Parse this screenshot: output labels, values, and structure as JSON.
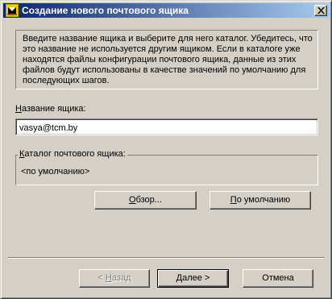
{
  "window": {
    "title": "Создание нового почтового ящика"
  },
  "description": "Введите название ящика и выберите для него каталог. Убедитесь, что это название не используется другим ящиком. Если в каталоге уже находятся файлы конфигурации почтового ящика, данные из этих файлов будут использованы в качестве значений по умолчанию для последующих шагов.",
  "mailbox_name": {
    "label_accel": "Н",
    "label_rest": "азвание ящика:",
    "value": "vasya@tcm.by"
  },
  "catalog": {
    "label_accel": "К",
    "label_rest": "аталог почтового ящика:",
    "value": "<по умолчанию>"
  },
  "buttons": {
    "browse_accel": "О",
    "browse_rest": "бзор...",
    "default_accel": "П",
    "default_rest": "о умолчанию",
    "back_prefix": "< ",
    "back_accel": "Н",
    "back_rest": "азад",
    "next_accel": "Д",
    "next_rest": "алее >",
    "cancel": "Отмена"
  },
  "icons": {
    "app": "mailbox-wizard-icon",
    "close": "close-icon"
  }
}
